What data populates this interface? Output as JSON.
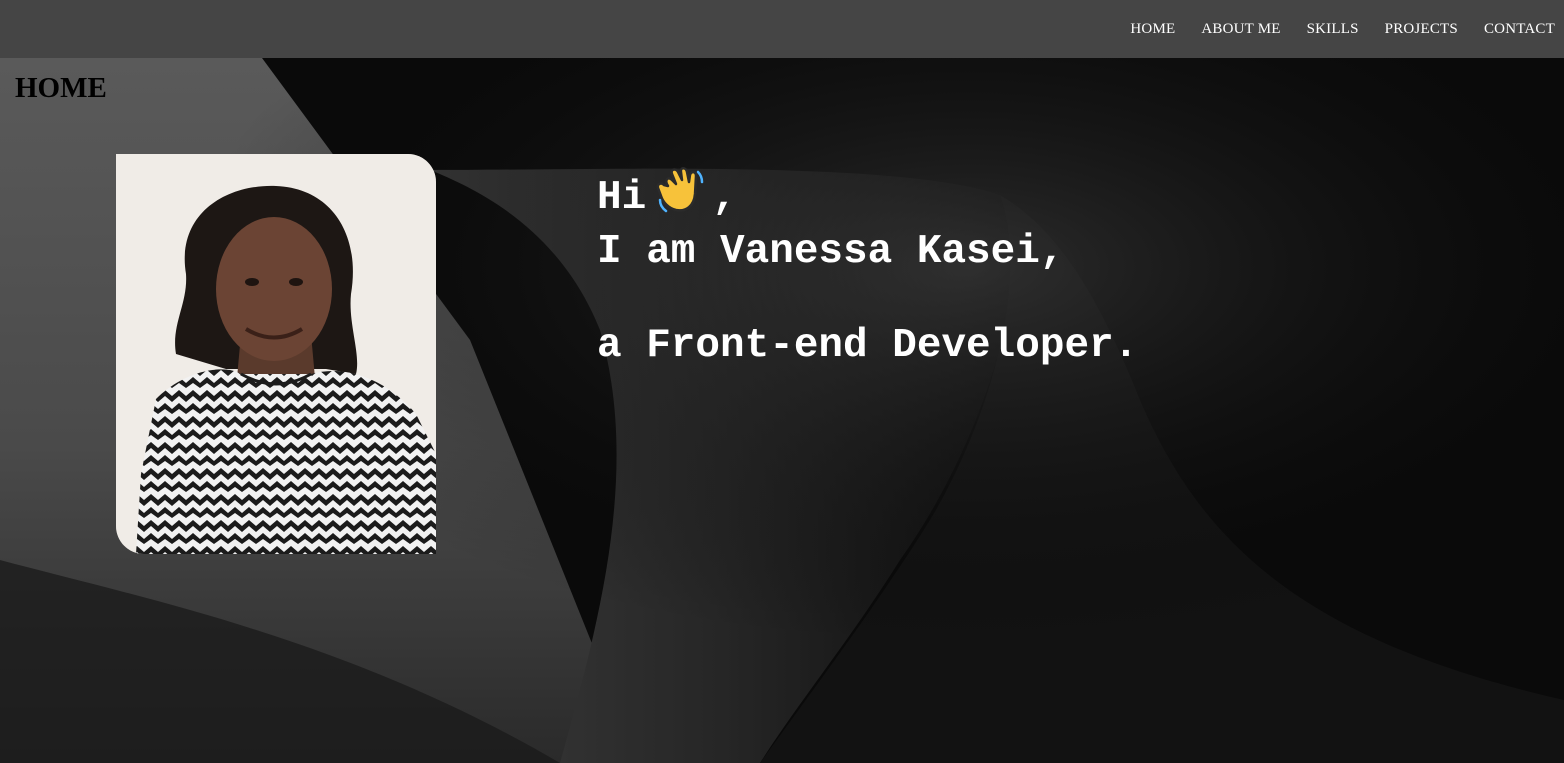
{
  "nav": {
    "items": [
      {
        "label": "HOME"
      },
      {
        "label": "ABOUT ME"
      },
      {
        "label": "SKILLS"
      },
      {
        "label": "PROJECTS"
      },
      {
        "label": "CONTACT"
      }
    ]
  },
  "home": {
    "section_title": "HOME",
    "greeting": "Hi",
    "greeting_suffix": ",",
    "intro_line": "I am Vanessa Kasei,",
    "role_line": "a Front-end Developer.",
    "wave_icon": "waving-hand-icon",
    "portrait_icon": "profile-photo"
  },
  "colors": {
    "navbar": "#454545",
    "nav_text": "#ffffff",
    "intro_text": "#ffffff",
    "section_title": "#000000"
  }
}
